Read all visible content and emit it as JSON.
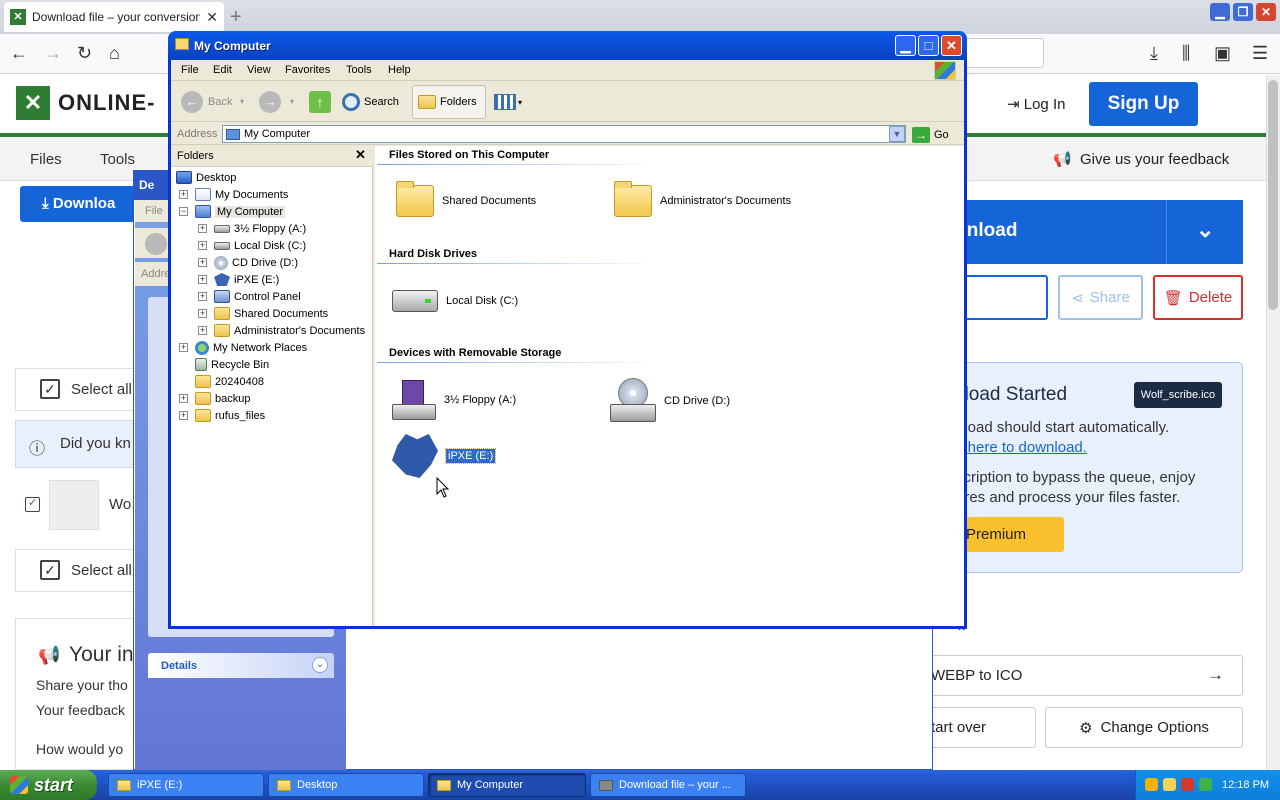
{
  "browser": {
    "tab_title": "Download file – your conversion w",
    "tab_close": "✕",
    "new_tab": "+",
    "min": "▁",
    "max": "❐",
    "close": "✕"
  },
  "website": {
    "logo_text": "ONLINE-",
    "nav": {
      "files": "Files",
      "tools": "Tools"
    },
    "login": "Log In",
    "signup": "Sign Up",
    "feedback": "Give us your feedback",
    "download_btn": "Downloa",
    "download_big": "wnload",
    "input_partial": "s",
    "share": "Share",
    "delete": "Delete",
    "started_title": "nload Started",
    "file_badge": "Wolf_scribe.ico",
    "started_line1": "nload should start automatically.",
    "started_line2": "k here to download.",
    "started_line3": "scription to bypass the queue, enjoy",
    "started_line4": "ures and process your files faster.",
    "premium": "Premium",
    "k_text": "k",
    "webp_to_ico": "WEBP to ICO",
    "start_over": "tart over",
    "change_options": "Change Options",
    "select_all_1": "Select all",
    "did_you": "Did you kn",
    "file_name": "Wo",
    "select_all_2": "Select all",
    "your_title": "Your in",
    "share_your": "Share your tho",
    "your_feedback": "Your feedback",
    "how_would": "How would yo"
  },
  "bg_window": {
    "title": "De",
    "menu_file": "File",
    "address": "Addre",
    "details": "Details"
  },
  "explorer": {
    "title": "My Computer",
    "menu": [
      "File",
      "Edit",
      "View",
      "Favorites",
      "Tools",
      "Help"
    ],
    "toolbar": {
      "back": "Back",
      "search": "Search",
      "folders": "Folders"
    },
    "address_label": "Address",
    "address_value": "My Computer",
    "go": "Go",
    "folders_header": "Folders",
    "folders_close": "✕",
    "tree": [
      "Desktop",
      "My Documents",
      "My Computer",
      "3½ Floppy (A:)",
      "Local Disk (C:)",
      "CD Drive (D:)",
      "iPXE (E:)",
      "Control Panel",
      "Shared Documents",
      "Administrator's Documents",
      "My Network Places",
      "Recycle Bin",
      "20240408",
      "backup",
      "rufus_files"
    ],
    "groups": {
      "stored": "Files Stored on This Computer",
      "hdd": "Hard Disk Drives",
      "removable": "Devices with Removable Storage"
    },
    "items": {
      "shared_docs": "Shared Documents",
      "admin_docs": "Administrator's Documents",
      "local_disk": "Local Disk (C:)",
      "floppy": "3½ Floppy (A:)",
      "cd": "CD Drive (D:)",
      "ipxe": "iPXE (E:)"
    }
  },
  "taskbar": {
    "start": "start",
    "tasks": [
      "iPXE (E:)",
      "Desktop",
      "My Computer",
      "Download file – your ..."
    ],
    "clock": "12:18 PM"
  }
}
